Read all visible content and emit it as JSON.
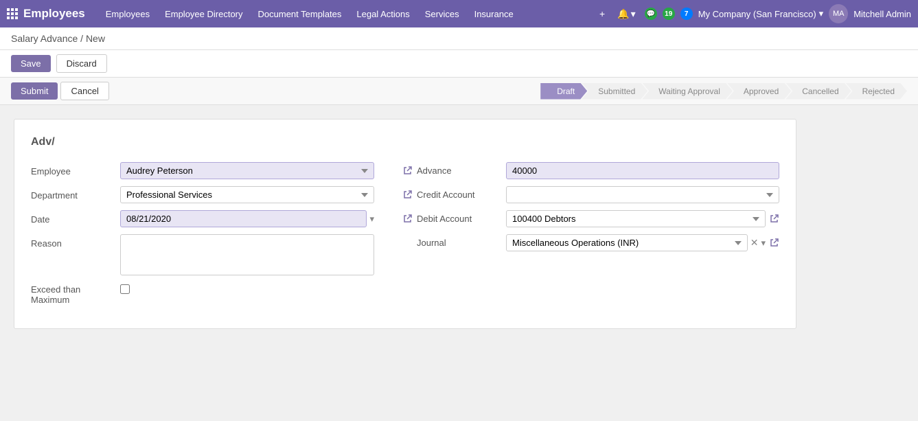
{
  "navbar": {
    "app_icon": "grid-icon",
    "title": "Employees",
    "nav_items": [
      {
        "label": "Employees",
        "key": "employees"
      },
      {
        "label": "Employee Directory",
        "key": "employee-directory"
      },
      {
        "label": "Document Templates",
        "key": "document-templates"
      },
      {
        "label": "Legal Actions",
        "key": "legal-actions"
      },
      {
        "label": "Services",
        "key": "services"
      },
      {
        "label": "Insurance",
        "key": "insurance"
      }
    ],
    "add_button": "+",
    "notifications_count": "19",
    "messages_count": "7",
    "company": "My Company (San Francisco)",
    "user": "Mitchell Admin"
  },
  "breadcrumb": {
    "path": "Salary Advance / New"
  },
  "actions": {
    "save_label": "Save",
    "discard_label": "Discard",
    "submit_label": "Submit",
    "cancel_label": "Cancel"
  },
  "pipeline": {
    "steps": [
      {
        "label": "Draft",
        "active": true
      },
      {
        "label": "Submitted",
        "active": false
      },
      {
        "label": "Waiting Approval",
        "active": false
      },
      {
        "label": "Approved",
        "active": false
      },
      {
        "label": "Cancelled",
        "active": false
      },
      {
        "label": "Rejected",
        "active": false
      }
    ]
  },
  "form": {
    "title": "Adv/",
    "employee_label": "Employee",
    "employee_value": "Audrey Peterson",
    "department_label": "Department",
    "department_value": "Professional Services",
    "date_label": "Date",
    "date_value": "08/21/2020",
    "reason_label": "Reason",
    "reason_value": "",
    "exceed_label_1": "Exceed than",
    "exceed_label_2": "Maximum",
    "advance_label": "Advance",
    "advance_value": "40000",
    "credit_account_label": "Credit Account",
    "credit_account_value": "",
    "debit_account_label": "Debit Account",
    "debit_account_value": "100400 Debtors",
    "journal_label": "Journal",
    "journal_value": "Miscellaneous Operations (INR)"
  }
}
